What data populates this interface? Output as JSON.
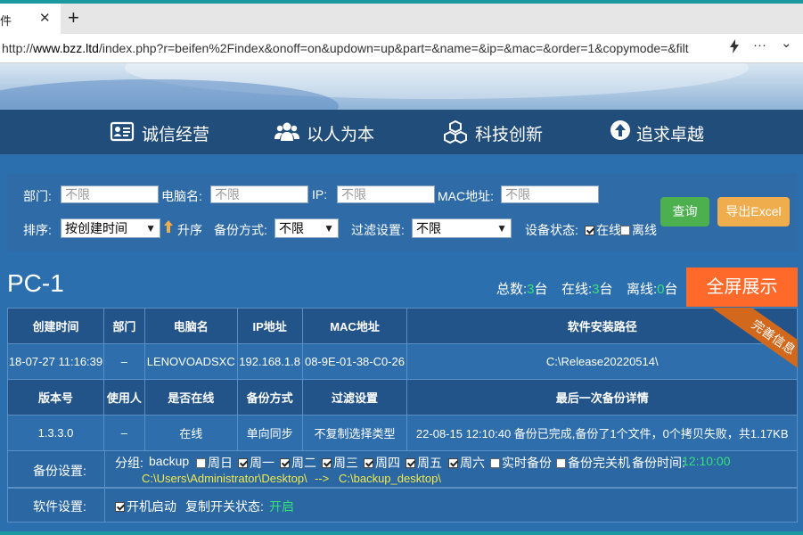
{
  "browser": {
    "tab_title": "件",
    "close_glyph": "✕",
    "new_tab_glyph": "+",
    "url_prefix": "http://",
    "url_host": "www.bzz.ltd",
    "url_path": "/index.php?r=beifen%2Findex&onoff=on&updown=up&part=&name=&ip=&mac=&order=1&copymode=&filt",
    "more_glyph": "···",
    "chevron_glyph": "⌄"
  },
  "nav": {
    "items": [
      {
        "label": "诚信经营",
        "icon": "id-card-icon"
      },
      {
        "label": "以人为本",
        "icon": "users-icon"
      },
      {
        "label": "科技创新",
        "icon": "cubes-icon"
      },
      {
        "label": "追求卓越",
        "icon": "arrow-up-circle-icon"
      }
    ]
  },
  "filter": {
    "department_label": "部门:",
    "department_placeholder": "不限",
    "pcname_label": "电脑名:",
    "pcname_placeholder": "不限",
    "ip_label": "IP:",
    "ip_placeholder": "不限",
    "mac_label": "MAC地址:",
    "mac_placeholder": "不限",
    "query_button": "查询",
    "export_button": "导出Excel",
    "sort_label": "排序:",
    "sort_value": "按创建时间",
    "sort_dir_arrow": "🠕",
    "sort_dir_label": "升序",
    "backup_mode_label": "备份方式:",
    "backup_mode_value": "不限",
    "filter_setting_label": "过滤设置:",
    "filter_setting_value": "不限",
    "device_status_label": "设备状态:",
    "online_label": "在线",
    "offline_label": "离线",
    "online_checked": true,
    "offline_checked": false
  },
  "device": {
    "title": "PC-1",
    "stats": {
      "total_label": "总数:",
      "total": "3",
      "total_unit": "台",
      "online_label": "在线:",
      "online": "3",
      "online_unit": "台",
      "offline_label": "离线:",
      "offline": "0",
      "offline_unit": "台"
    },
    "fullscreen_button": "全屏展示",
    "ribbon": "完善信息",
    "headers1": [
      "创建时间",
      "部门",
      "电脑名",
      "IP地址",
      "MAC地址",
      "软件安装路径"
    ],
    "values1": [
      "18-07-27 11:16:39",
      "–",
      "LENOVOADSXC",
      "192.168.1.8",
      "08-9E-01-38-C0-26",
      "C:\\Release20220514\\"
    ],
    "headers2": [
      "版本号",
      "使用人",
      "是否在线",
      "备份方式",
      "过滤设置",
      "最后一次备份详情"
    ],
    "values2": [
      "1.3.3.0",
      "–",
      "在线",
      "单向同步",
      "不复制选择类型",
      "22-08-15 12:10:40 备份已完成,备份了1个文件，0个拷贝失败，共1.17KB"
    ],
    "backup_settings": {
      "label": "备份设置:",
      "group_label": "分组:",
      "group": "backup",
      "days": [
        {
          "label": "周日",
          "checked": false
        },
        {
          "label": "周一",
          "checked": true
        },
        {
          "label": "周二",
          "checked": true
        },
        {
          "label": "周三",
          "checked": true
        },
        {
          "label": "周四",
          "checked": true
        },
        {
          "label": "周五",
          "checked": true
        },
        {
          "label": "周六",
          "checked": true
        },
        {
          "label": "实时备份",
          "checked": false
        },
        {
          "label": "备份完关机",
          "checked": false
        }
      ],
      "time_label": "备份时间:",
      "time": "12:10:00",
      "source": "C:\\Users\\Administrator\\Desktop\\",
      "arrow": "-->",
      "target": "C:\\backup_desktop\\"
    },
    "software_settings": {
      "label": "软件设置:",
      "autostart_label": "开机启动",
      "autostart_checked": true,
      "switch_label": "复制开关状态:",
      "switch_value": "开启"
    }
  },
  "colors": {
    "page_bg": "#2c6fae",
    "nav_bg": "#214d7a",
    "query_btn": "#4cb04f",
    "export_btn": "#f0ad4e",
    "fullscreen_btn": "#ff6a2b",
    "ribbon": "#d2681c",
    "highlight_green": "#35e07a",
    "path_yellow": "#f2e94c"
  }
}
